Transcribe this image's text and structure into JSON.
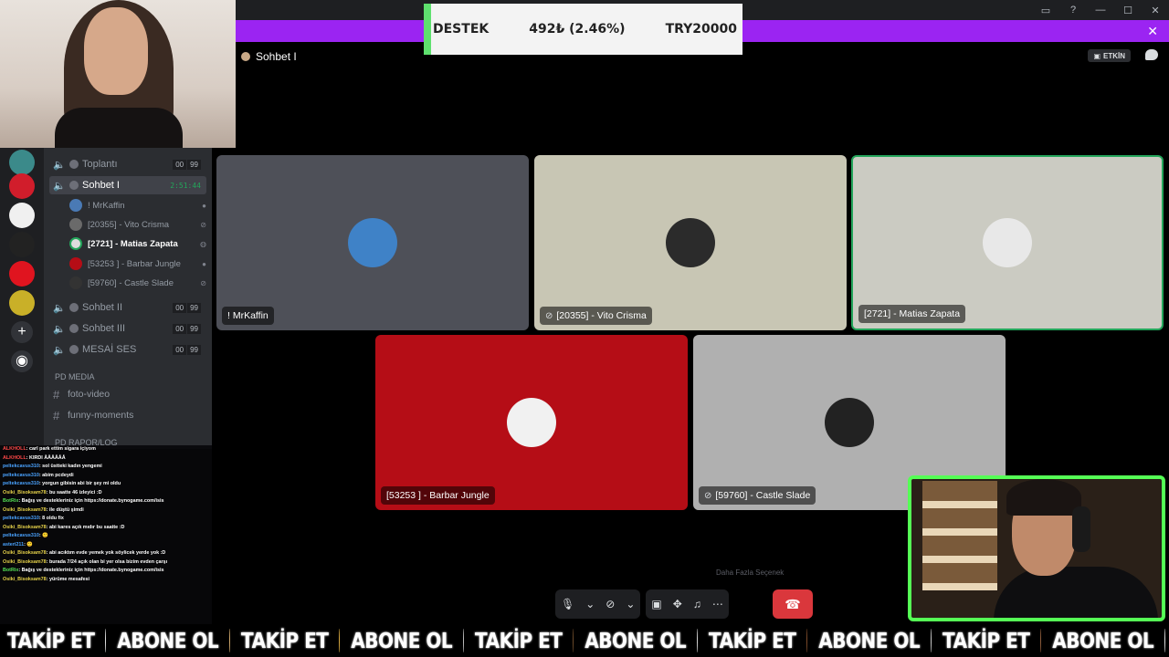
{
  "donation": {
    "label": "DESTEK",
    "amount": "492₺ (2.46%)",
    "goal": "TRY20000"
  },
  "header": {
    "channel_name": "Sohbet I",
    "activity_label": "ETKİN"
  },
  "voice_channels": [
    {
      "label": "Toplantı",
      "c1": "00",
      "c2": "99"
    },
    {
      "label": "Sohbet I",
      "timer": "2:51:44"
    },
    {
      "label": "Sohbet II",
      "c1": "00",
      "c2": "99"
    },
    {
      "label": "Sohbet III",
      "c1": "00",
      "c2": "99"
    },
    {
      "label": "MESAİ SES",
      "c1": "00",
      "c2": "99"
    }
  ],
  "members": [
    {
      "name": "! MrKaffin"
    },
    {
      "name": "[20355] - Vito Crisma"
    },
    {
      "name": "[2721] - Matias Zapata"
    },
    {
      "name": "[53253 ] - Barbar Jungle"
    },
    {
      "name": "[59760] - Castle Slade"
    }
  ],
  "categories": {
    "media": "PD MEDIA",
    "log": "PD RAPOR/LOG"
  },
  "text_channels": [
    {
      "label": "foto-video"
    },
    {
      "label": "funny-moments"
    }
  ],
  "chat_lines": [
    {
      "user": "ALKHOLL",
      "text": ": carl park ettim sigara içiyom"
    },
    {
      "user": "ALKHOLL",
      "text": ": KIRDI ÅÅÅÅÅÅ"
    },
    {
      "user": "peltekcavus310",
      "text": ": sol üstteki kadın yengemi"
    },
    {
      "user": "peltekcavus310",
      "text": ": abim pcdeydi"
    },
    {
      "user": "peltekcavus310",
      "text": ": yorgun gibisin abi bir şey mi oldu"
    },
    {
      "user": "Osiki_Bisoksam78",
      "text": ": bu saatte 46 izleyici :D"
    },
    {
      "user": "BotRix",
      "text": ": Bağış ve destekleriniz için https://donate.bynogame.com/isis"
    },
    {
      "user": "Osiki_Bisoksam78",
      "text": ": ile düştü şimdi"
    },
    {
      "user": "peltekcavus310",
      "text": ": 8 oldu fix"
    },
    {
      "user": "Osiki_Bisoksam78",
      "text": ": abi kares açık mıdır bu saatte :D"
    },
    {
      "user": "peltekcavus310",
      "text": ": 🙂"
    },
    {
      "user": "asteri211",
      "text": ": 🙂"
    },
    {
      "user": "Osiki_Bisoksam78",
      "text": ": abi acıktım evde yemek yok söylicek yerde yok :D"
    },
    {
      "user": "Osiki_Bisoksam78",
      "text": ": burada 7/24 açık olan bi yer olsa bizim evden çarşı"
    },
    {
      "user": "BotRix",
      "text": ": Bağış ve destekleriniz için https://donate.bynogame.com/isis"
    },
    {
      "user": "Osiki_Bisoksam78",
      "text": ": yürüme mesafesi"
    }
  ],
  "tiles": [
    {
      "name": "! MrKaffin",
      "muted": false,
      "color": "#4e5058"
    },
    {
      "name": "[20355] - Vito Crisma",
      "muted": true,
      "color": "#c8c6b4"
    },
    {
      "name": "[2721] - Matias Zapata",
      "muted": false,
      "color": "#cbcbc2"
    },
    {
      "name": "[53253 ] - Barbar Jungle",
      "muted": false,
      "color": "#b50d16"
    },
    {
      "name": "[59760] - Castle Slade",
      "muted": true,
      "color": "#b0b0b0"
    }
  ],
  "controls": {
    "more_hint": "Daha Fazla Seçenek"
  },
  "ticker": [
    "TAKİP ET",
    "ABONE OL",
    "TAKİP ET",
    "ABONE OL",
    "TAKİP ET",
    "ABONE OL",
    "TAKİP ET",
    "ABONE OL",
    "TAKİP ET",
    "ABONE OL"
  ],
  "colors": {
    "accent": "#9b24f2",
    "speaking": "#23a55a",
    "endcall": "#da373c",
    "cam_border": "#55ff55"
  }
}
